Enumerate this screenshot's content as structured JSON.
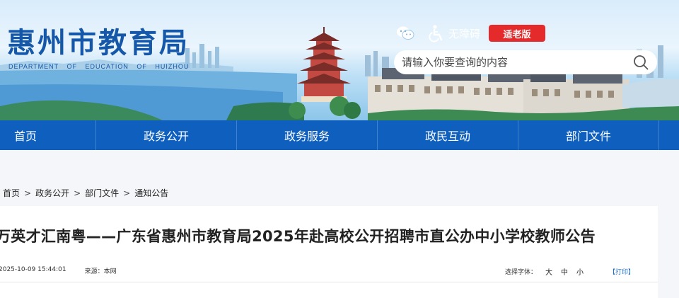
{
  "site": {
    "title": "惠州市教育局",
    "subtitle": "DEPARTMENT OF EDUCATION OF HUIZHOU"
  },
  "tools": {
    "accessibility_label": "无障碍",
    "elder_label": "适老版"
  },
  "search": {
    "placeholder": "请输入你要查询的内容"
  },
  "nav": {
    "items": [
      "首页",
      "政务公开",
      "政务服务",
      "政民互动",
      "部门文件"
    ]
  },
  "breadcrumb": {
    "items": [
      "首页",
      "政务公开",
      "部门文件",
      "通知公告"
    ],
    "separator": ">"
  },
  "article": {
    "title": "万英才汇南粤——广东省惠州市教育局2025年赴高校公开招聘市直公办中小学校教师公告",
    "date": "2025-10-09 15:44:01",
    "source": "来源：本网",
    "font_label": "选择字体：",
    "font_large": "大",
    "font_medium": "中",
    "font_small": "小",
    "print": "【打印】"
  },
  "colors": {
    "brand_blue": "#1557a8",
    "nav_blue": "#0e5fbe",
    "elder_red": "#e42a2a",
    "link_blue": "#1a6ed1"
  }
}
